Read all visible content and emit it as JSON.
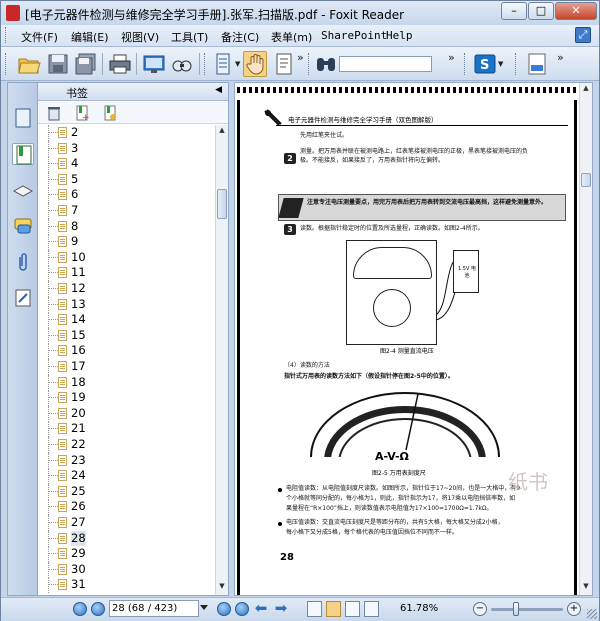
{
  "window": {
    "title": "[电子元器件检测与维修完全学习手册].张军.扫描版.pdf - Foxit Reader",
    "min_label": "–",
    "max_label": "□",
    "close_label": "✕"
  },
  "menu": {
    "items": [
      "文件(F)",
      "编辑(E)",
      "视图(V)",
      "工具(T)",
      "备注(C)",
      "表单(m)",
      "SharePoint",
      "Help"
    ]
  },
  "sidebar": {
    "panel_title": "书签",
    "collapse_glyph": "◀",
    "bookmarks": [
      "2",
      "3",
      "4",
      "5",
      "6",
      "7",
      "8",
      "9",
      "10",
      "11",
      "12",
      "13",
      "14",
      "15",
      "16",
      "17",
      "18",
      "19",
      "20",
      "21",
      "22",
      "23",
      "24",
      "25",
      "26",
      "27",
      "28",
      "29",
      "30",
      "31"
    ],
    "selected": "28"
  },
  "document": {
    "running_head": "电子元器件检测与维修完全学习手册（双色图解版）",
    "page_number": "28",
    "line_1": "先用红笔夹住试。",
    "line_2": "测量。把万用表并联在被测电路上，红表笔接被测电压的正极，黑表笔接被测电压的负",
    "line_3": "极。不能接反，如果接反了，万用表指针将向左偏转。",
    "note_text": "注意专注电压测量要点，用完万用表后把万用表转到交流电压最高挡，这样避免测量意外。",
    "line_4": "读数。根据指针稳定时的位置及所选量程，正确读数。如图2-4所示。",
    "fig1_caption": "图2-4  测量直流电压",
    "probe_label": "1.5V 电池",
    "section_title": "（4）读数的方法",
    "section_line": "指针式万用表的读数方法如下（假设指针停在图2-5中的位置）。",
    "dial_label": "A-V-Ω",
    "fig2_caption": "图2-5  万用表刻度尺",
    "bullet_1a": "电阻值读数：从电阻值刻度尺读数。如图所示，指针位于17~20间，也是一大格中，有9",
    "bullet_1b": "个小格就等同分配的，每小格为1，则此，指针指示为17，将17乘以电阻挡倍率数，如",
    "bullet_1c": "果量程在“R×100”挡上，则读数值表示电阻值为17×100=1700Ω=1.7kΩ。",
    "bullet_2a": "电压值读数：交直流电压刻度尺是等距分布的，共有5大格，每大格又分成2小格，",
    "bullet_2b": "每小格下又分成5格，每个格代表的电压值因挡位不同而不一样。",
    "watermark": "纸书"
  },
  "statusbar": {
    "page_field": "28 (68 / 423)",
    "zoom": "61.78%",
    "zoom_minus": "−",
    "zoom_plus": "+"
  }
}
